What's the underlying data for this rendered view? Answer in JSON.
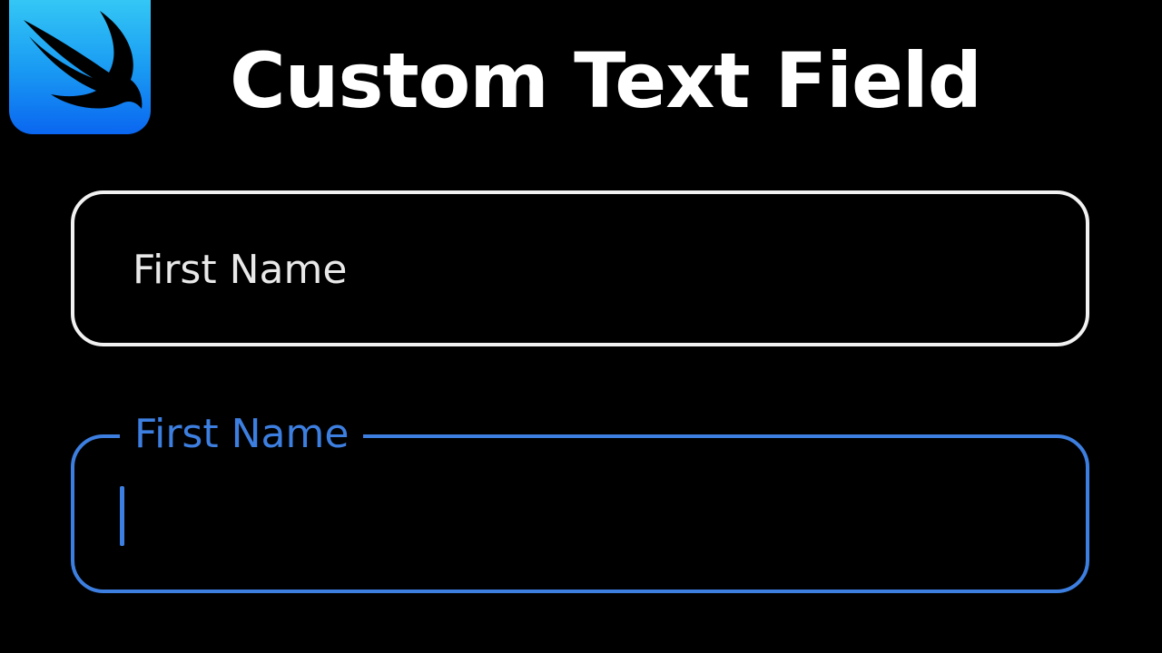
{
  "header": {
    "logo_icon": "swift-logo-icon",
    "title": "Custom Text Field"
  },
  "fields": {
    "inactive": {
      "placeholder": "First Name",
      "border_color": "#f2f2f2",
      "state": "unfocused"
    },
    "active": {
      "label": "First Name",
      "value": "",
      "border_color": "#3d7fe0",
      "state": "focused"
    }
  },
  "colors": {
    "background": "#000000",
    "accent": "#3d7fe0",
    "logo_gradient_top": "#34c7f5",
    "logo_gradient_bottom": "#0a66f0"
  }
}
